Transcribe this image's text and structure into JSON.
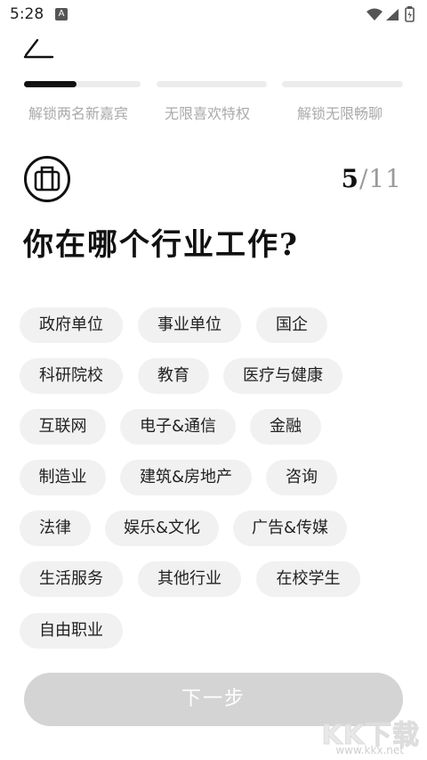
{
  "status_bar": {
    "time": "5:28",
    "app_icon_letter": "A"
  },
  "progress": [
    {
      "label": "解锁两名新嘉宾",
      "fill": 0.45
    },
    {
      "label": "无限喜欢特权",
      "fill": 0
    },
    {
      "label": "解锁无限畅聊",
      "fill": 0
    }
  ],
  "counter": {
    "current": "5",
    "total": "/11"
  },
  "question": "你在哪个行业工作?",
  "options": [
    "政府单位",
    "事业单位",
    "国企",
    "科研院校",
    "教育",
    "医疗与健康",
    "互联网",
    "电子&通信",
    "金融",
    "制造业",
    "建筑&房地产",
    "咨询",
    "法律",
    "娱乐&文化",
    "广告&传媒",
    "生活服务",
    "其他行业",
    "在校学生",
    "自由职业"
  ],
  "next_button": "下一步",
  "watermark": {
    "text": "KK下载",
    "url": "www.kkx.net"
  },
  "colors": {
    "accent": "#111111",
    "chip_bg": "#f1f1f1",
    "button_disabled": "#d4d4d4"
  }
}
